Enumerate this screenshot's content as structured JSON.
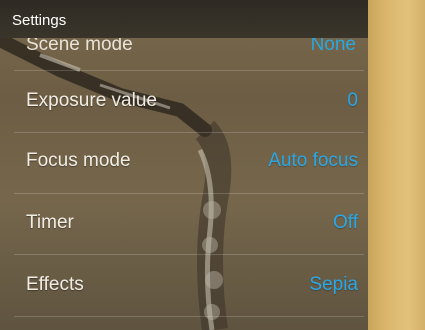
{
  "window": {
    "title": "Settings"
  },
  "settings": {
    "partial_item": {
      "label": "Scene mode",
      "value": "None"
    },
    "items": [
      {
        "label": "Exposure value",
        "value": "0"
      },
      {
        "label": "Focus mode",
        "value": "Auto focus"
      },
      {
        "label": "Timer",
        "value": "Off"
      },
      {
        "label": "Effects",
        "value": "Sepia"
      }
    ]
  },
  "colors": {
    "title_bar": "#2e2a23",
    "value_accent": "#2aa7e6",
    "label_text": "#f1ede4"
  }
}
